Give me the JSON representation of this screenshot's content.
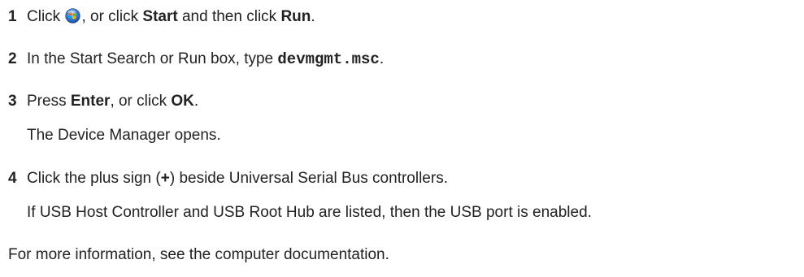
{
  "steps": [
    {
      "number": "1",
      "line": {
        "t1": "Click ",
        "icon": "windows-start-orb-icon",
        "t2": ", or click ",
        "b1": "Start",
        "t3": " and then click ",
        "b2": "Run",
        "t4": "."
      }
    },
    {
      "number": "2",
      "line": {
        "t1": "In the Start Search or Run box, type ",
        "code": "devmgmt.msc",
        "t2": "."
      }
    },
    {
      "number": "3",
      "line": {
        "t1": "Press ",
        "b1": "Enter",
        "t2": ", or click ",
        "b2": "OK",
        "t3": "."
      },
      "result": "The Device Manager opens."
    },
    {
      "number": "4",
      "line": {
        "t1": "Click the plus sign (",
        "b1": "+",
        "t2": ") beside Universal Serial Bus controllers."
      },
      "result": "If USB Host Controller and USB Root Hub are listed, then the USB port is enabled."
    }
  ],
  "footer": "For more information, see the computer documentation.",
  "colors": {
    "text": "#222222",
    "orb_blue": "#3a7fd0"
  }
}
